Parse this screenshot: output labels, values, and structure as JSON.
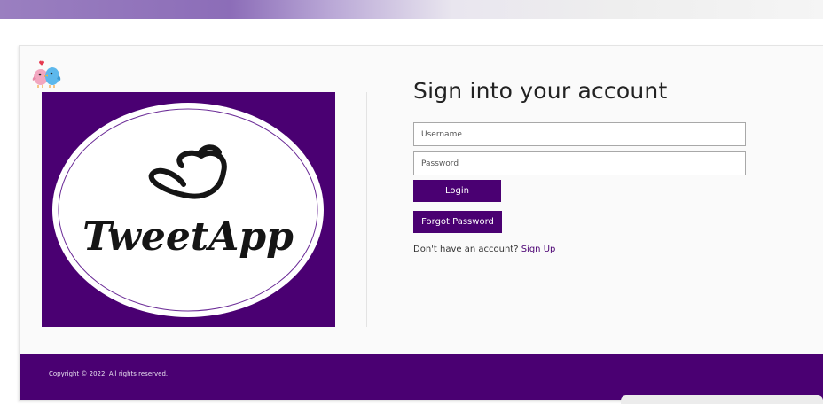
{
  "browser": {
    "gradient_colors": [
      "#8c6db8",
      "#eeeeee"
    ]
  },
  "brand": {
    "small_logo_icon": "love-birds-icon",
    "hero_icon": "bird-outline-icon",
    "hero_text": "TweetApp",
    "primary_color": "#4a0072"
  },
  "login": {
    "title": "Sign into your account",
    "username_placeholder": "Username",
    "password_placeholder": "Password",
    "login_label": "Login",
    "forgot_label": "Forgot Password",
    "no_account_text": "Don't have an account?",
    "signup_label": "Sign Up"
  },
  "footer": {
    "copyright": "Copyright © 2022. All rights reserved."
  }
}
